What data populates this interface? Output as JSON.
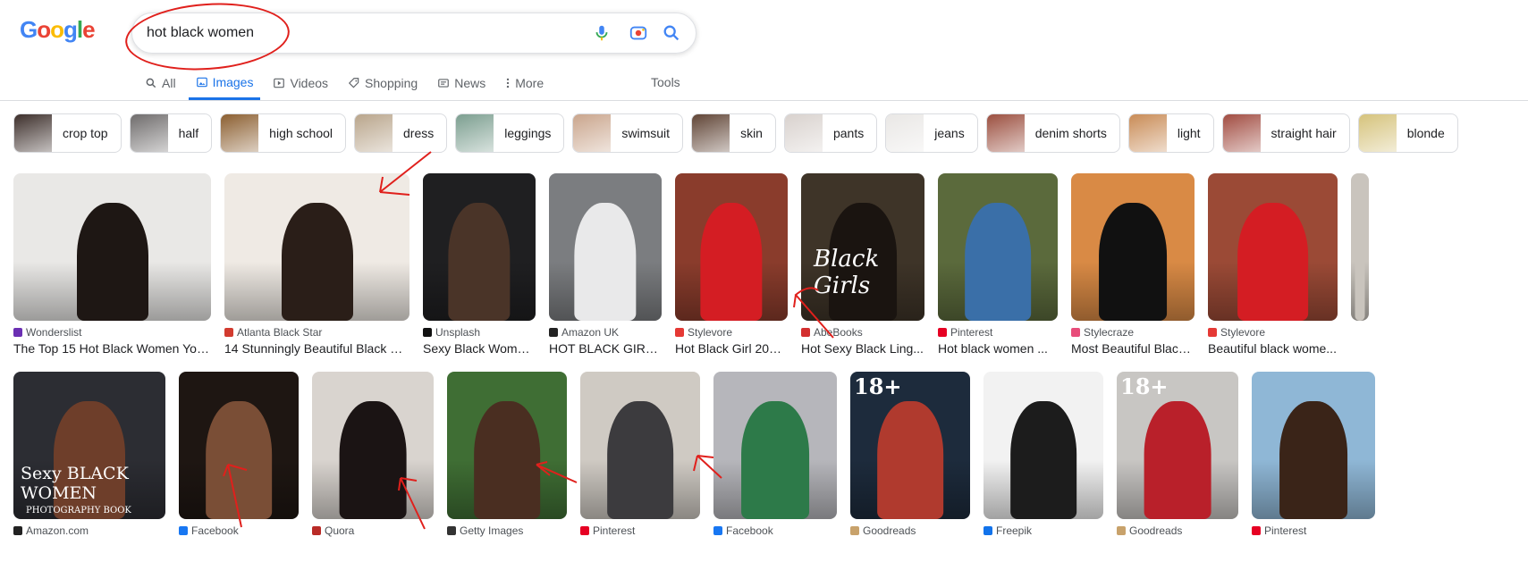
{
  "logo": {
    "letters": [
      "G",
      "o",
      "o",
      "g",
      "l",
      "e"
    ],
    "colors": [
      "#4285f4",
      "#ea4335",
      "#fbbc05",
      "#4285f4",
      "#34a853",
      "#ea4335"
    ]
  },
  "search": {
    "query": "hot black women"
  },
  "tabs": [
    {
      "label": "All",
      "icon": "search-icon"
    },
    {
      "label": "Images",
      "icon": "image-icon",
      "active": true
    },
    {
      "label": "Videos",
      "icon": "play-icon"
    },
    {
      "label": "Shopping",
      "icon": "tag-icon"
    },
    {
      "label": "News",
      "icon": "news-icon"
    },
    {
      "label": "More",
      "icon": "more-icon"
    }
  ],
  "tools_label": "Tools",
  "chips": [
    {
      "label": "crop top",
      "w": 109,
      "color": "#3a2c28"
    },
    {
      "label": "half",
      "w": 92,
      "color": "#6d6a6a"
    },
    {
      "label": "high school",
      "w": 137,
      "color": "#8a5d2e"
    },
    {
      "label": "dress",
      "w": 100,
      "color": "#b8a48a"
    },
    {
      "label": "leggings",
      "w": 118,
      "color": "#7a9d8e"
    },
    {
      "label": "swimsuit",
      "w": 120,
      "color": "#c9a48b"
    },
    {
      "label": "skin",
      "w": 92,
      "color": "#5e4233"
    },
    {
      "label": "pants",
      "w": 103,
      "color": "#d8d1cd"
    },
    {
      "label": "jeans",
      "w": 108,
      "color": "#e9e7e5"
    },
    {
      "label": "denim shorts",
      "w": 147,
      "color": "#9a4d3d"
    },
    {
      "label": "light",
      "w": 96,
      "color": "#c88a54"
    },
    {
      "label": "straight hair",
      "w": 140,
      "color": "#a04a3f"
    },
    {
      "label": "blonde",
      "w": 100,
      "color": "#d5c27a"
    }
  ],
  "row1": [
    {
      "source": "Wonderslist",
      "title": "The Top 15 Hot Black Women You'...",
      "w": 221,
      "bg": "#e9e8e6",
      "fig": "#1e1714",
      "fav": "#6b2fb3"
    },
    {
      "source": "Atlanta Black Star",
      "title": "14 Stunningly Beautiful Black W...",
      "w": 207,
      "bg": "#efeae4",
      "fig": "#2a1e18",
      "fav": "#d23b2f"
    },
    {
      "source": "Unsplash",
      "title": "Sexy Black Woman ...",
      "w": 126,
      "bg": "#1f1f21",
      "fig": "#4a3428",
      "fav": "#111111"
    },
    {
      "source": "Amazon UK",
      "title": "HOT BLACK GIRLS...",
      "w": 126,
      "bg": "#7b7d80",
      "fig": "#e9e9ea",
      "fav": "#222222"
    },
    {
      "source": "Stylevore",
      "title": "Hot Black Girl 2019 ...",
      "w": 126,
      "bg": "#8a3c2c",
      "fig": "#d41d23",
      "fav": "#e53935"
    },
    {
      "source": "AbeBooks",
      "title": "Hot Sexy Black Ling...",
      "w": 138,
      "bg": "#3e3428",
      "fig": "#1a1410",
      "fav": "#d32f2f",
      "overlay": "Black Girls"
    },
    {
      "source": "Pinterest",
      "title": "Hot black women ...",
      "w": 134,
      "bg": "#5b6a3c",
      "fig": "#3a6fa8",
      "fav": "#e60023"
    },
    {
      "source": "Stylecraze",
      "title": "Most Beautiful Black...",
      "w": 138,
      "bg": "#d98a45",
      "fig": "#111111",
      "fav": "#e84d7a"
    },
    {
      "source": "Stylevore",
      "title": "Beautiful black wome...",
      "w": 145,
      "bg": "#9b4a36",
      "fig": "#d41d23",
      "fav": "#e53935"
    },
    {
      "source": "",
      "title": "",
      "w": 20,
      "bg": "#c9c4bd",
      "fig": "#c9c4bd",
      "fav": "#cccccc"
    }
  ],
  "row2": [
    {
      "source": "Amazon.com",
      "title": "",
      "w": 170,
      "bg": "#2c2d33",
      "fig": "#6e3e2a",
      "fav": "#222222",
      "overlay": "Sexy BLACK WOMEN",
      "overlay2": "PHOTOGRAPHY BOOK"
    },
    {
      "source": "Facebook",
      "title": "",
      "w": 134,
      "bg": "#1e1612",
      "fig": "#7a4e36",
      "fav": "#1877f2"
    },
    {
      "source": "Quora",
      "title": "",
      "w": 136,
      "bg": "#d9d4cf",
      "fig": "#1b1414",
      "fav": "#b92b27"
    },
    {
      "source": "Getty Images",
      "title": "",
      "w": 134,
      "bg": "#3f6e34",
      "fig": "#4a2e21",
      "fav": "#333333"
    },
    {
      "source": "Pinterest",
      "title": "",
      "w": 134,
      "bg": "#cfcac3",
      "fig": "#3c3b3e",
      "fav": "#e60023"
    },
    {
      "source": "Facebook",
      "title": "",
      "w": 138,
      "bg": "#b6b6bb",
      "fig": "#2d7a49",
      "fav": "#1877f2"
    },
    {
      "source": "Goodreads",
      "title": "",
      "w": 134,
      "bg": "#1d2b3c",
      "fig": "#b03a2e",
      "fav": "#c8a26b",
      "overlay": "18+"
    },
    {
      "source": "Freepik",
      "title": "",
      "w": 134,
      "bg": "#f2f2f2",
      "fig": "#1c1c1c",
      "fav": "#1273eb"
    },
    {
      "source": "Goodreads",
      "title": "",
      "w": 136,
      "bg": "#c8c6c3",
      "fig": "#b9202a",
      "fav": "#c8a26b",
      "overlay": "18+"
    },
    {
      "source": "Pinterest",
      "title": "",
      "w": 138,
      "bg": "#8fb7d6",
      "fig": "#3a2418",
      "fav": "#e60023"
    }
  ]
}
